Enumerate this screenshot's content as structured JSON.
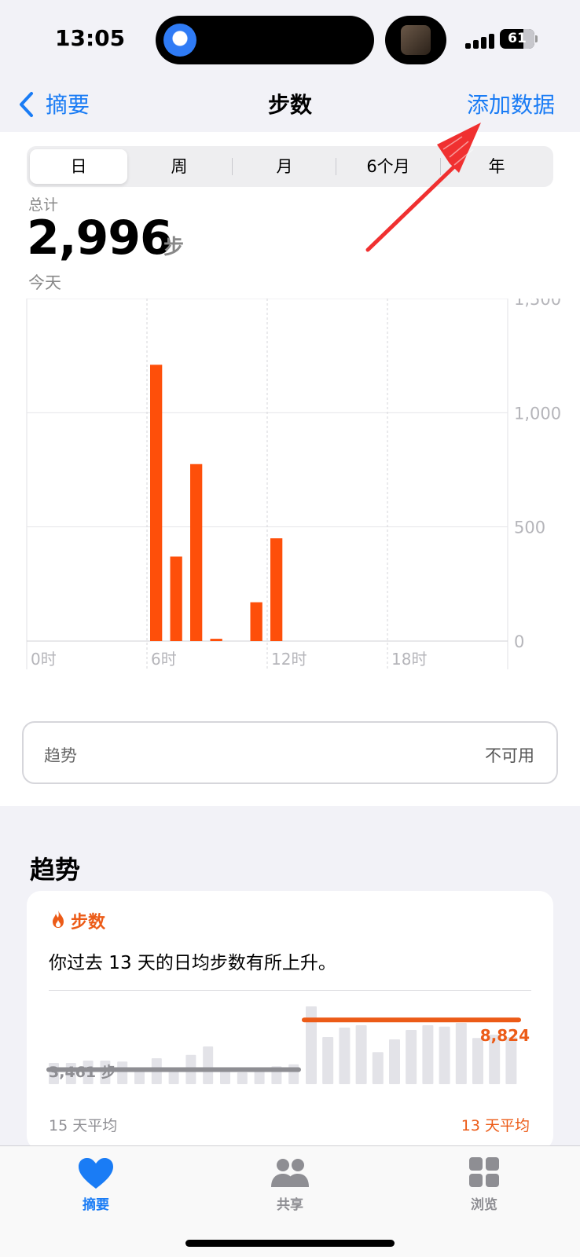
{
  "status": {
    "time": "13:05",
    "battery": "61"
  },
  "nav": {
    "back_label": "摘要",
    "title": "步数",
    "add_data": "添加数据"
  },
  "tabs_range": [
    {
      "label": "日",
      "active": true
    },
    {
      "label": "周",
      "active": false
    },
    {
      "label": "月",
      "active": false
    },
    {
      "label": "6个月",
      "active": false
    },
    {
      "label": "年",
      "active": false
    }
  ],
  "summary": {
    "label": "总计",
    "value": "2,996",
    "unit": "步",
    "date": "今天"
  },
  "chart_data": {
    "type": "bar",
    "x": [
      6,
      7,
      8,
      9,
      11,
      12
    ],
    "values": [
      1210,
      370,
      775,
      10,
      170,
      450
    ],
    "xlim": [
      0,
      24
    ],
    "ylim": [
      0,
      1500
    ],
    "y_ticks": [
      "1,500",
      "1,000",
      "500",
      "0"
    ],
    "y_tick_values": [
      1500,
      1000,
      500,
      0
    ],
    "x_ticks": [
      "0时",
      "6时",
      "12时",
      "18时"
    ],
    "x_tick_values": [
      0,
      6,
      12,
      18
    ],
    "color": "#fe4f0a"
  },
  "trend_card": {
    "label": "趋势",
    "value": "不可用"
  },
  "trends": {
    "title": "趋势",
    "metric": "步数",
    "description": "你过去 13 天的日均步数有所上升。",
    "left_avg_value": "3,461 步",
    "left_avg_label": "15 天平均",
    "right_avg_value": "8,824",
    "right_avg_label": "13 天平均",
    "left_bars": [
      0.45,
      0.45,
      0.5,
      0.5,
      0.48,
      0.35,
      0.55,
      0.3,
      0.62,
      0.8,
      0.28,
      0.25,
      0.3,
      0.38,
      0.42
    ],
    "right_bars": [
      1.65,
      1.0,
      1.2,
      1.25,
      0.68,
      0.95,
      1.15,
      1.25,
      1.22,
      1.3,
      0.98,
      1.05,
      1.0
    ],
    "accent_color": "#ec5b17"
  },
  "tabbar": [
    {
      "label": "摘要",
      "icon": "heart-icon",
      "active": true
    },
    {
      "label": "共享",
      "icon": "people-icon",
      "active": false
    },
    {
      "label": "浏览",
      "icon": "grid-icon",
      "active": false
    }
  ]
}
